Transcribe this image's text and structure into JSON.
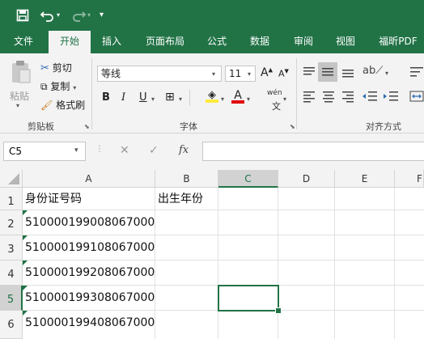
{
  "quick_access": {
    "save_icon": "save-icon",
    "undo_icon": "undo-icon",
    "redo_icon": "redo-icon",
    "customize_icon": "customize-icon"
  },
  "tabs": [
    "文件",
    "开始",
    "插入",
    "页面布局",
    "公式",
    "数据",
    "审阅",
    "视图",
    "福昕PDF"
  ],
  "active_tab": "开始",
  "clipboard": {
    "paste": "粘贴",
    "cut": "剪切",
    "copy": "复制",
    "format_painter": "格式刷",
    "group": "剪贴板"
  },
  "font": {
    "name": "等线",
    "size": "11",
    "bold": "B",
    "italic": "I",
    "underline": "U",
    "phonetic": "wén",
    "group": "字体"
  },
  "alignment": {
    "group": "对齐方式"
  },
  "formula_bar": {
    "name_box": "C5",
    "cancel": "✕",
    "enter": "✓",
    "fx": "fx",
    "formula": ""
  },
  "columns": [
    "A",
    "B",
    "C",
    "D",
    "E",
    "F"
  ],
  "selected_column": "C",
  "rows": [
    "1",
    "2",
    "3",
    "4",
    "5",
    "6"
  ],
  "selected_row": "5",
  "cells": {
    "A": [
      "身份证号码",
      "510000199008067000",
      "510000199108067000",
      "510000199208067000",
      "510000199308067000",
      "510000199408067000"
    ],
    "B": [
      "出生年份",
      "",
      "",
      "",
      "",
      ""
    ]
  },
  "colors": {
    "accent": "#217346",
    "font_color": "#e00000",
    "highlight": "#ffeb3b"
  }
}
